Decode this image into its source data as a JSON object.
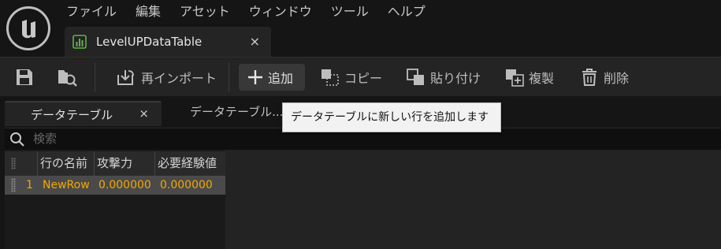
{
  "menubar": [
    "ファイル",
    "編集",
    "アセット",
    "ウィンドウ",
    "ツール",
    "ヘルプ"
  ],
  "asset_tab": {
    "label": "LevelUPDataTable",
    "close": "×"
  },
  "toolbar": {
    "save_icon": "floppy-disk-icon",
    "browse_icon": "browse-folder-icon",
    "reimport_label": "再インポート",
    "add_label": "追加",
    "copy_label": "コピー",
    "paste_label": "貼り付け",
    "duplicate_label": "複製",
    "delete_label": "削除"
  },
  "panel_tabs": {
    "active_label": "データテーブル",
    "active_close": "×",
    "second_label": "データテーブル..."
  },
  "search": {
    "placeholder": "検索"
  },
  "table": {
    "headers": [
      "行の名前",
      "攻撃力",
      "必要経験値"
    ],
    "rows": [
      {
        "index": "1",
        "name": "NewRow",
        "attack": "0.000000",
        "exp": "0.000000"
      }
    ]
  },
  "tooltip": {
    "text": "データテーブルに新しい行を追加します"
  },
  "colors": {
    "accent": "#f3a800",
    "selected_row": "#4a4a4a",
    "toolbar_bg": "#242424"
  }
}
